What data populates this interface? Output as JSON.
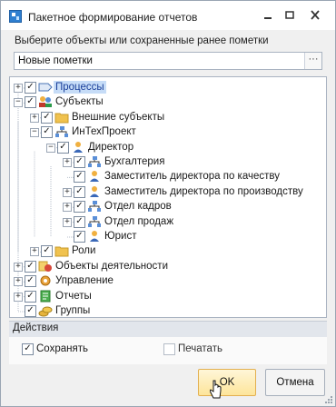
{
  "window": {
    "title": "Пакетное формирование отчетов"
  },
  "prompt": "Выберите объекты или сохраненные ранее пометки",
  "combo": {
    "value": "Новые пометки",
    "button": "···"
  },
  "tree": [
    {
      "label": "Процессы",
      "icon": "process-icon",
      "expander": "+",
      "checked": true,
      "selected": true
    },
    {
      "label": "Субъекты",
      "icon": "people-icon",
      "expander": "−",
      "checked": true
    },
    {
      "label": "Внешние субъекты",
      "icon": "folder-icon",
      "expander": "+",
      "checked": true
    },
    {
      "label": "ИнТехПроект",
      "icon": "org-icon",
      "expander": "−",
      "checked": true
    },
    {
      "label": "Директор",
      "icon": "person-icon",
      "expander": "−",
      "checked": true
    },
    {
      "label": "Бухгалтерия",
      "icon": "org-icon",
      "expander": "+",
      "checked": true
    },
    {
      "label": "Заместитель директора по качеству",
      "icon": "person-icon",
      "expander": "",
      "checked": true
    },
    {
      "label": "Заместитель директора по производству",
      "icon": "person-icon",
      "expander": "+",
      "checked": true
    },
    {
      "label": "Отдел кадров",
      "icon": "org-icon",
      "expander": "+",
      "checked": true
    },
    {
      "label": "Отдел продаж",
      "icon": "org-icon",
      "expander": "+",
      "checked": true
    },
    {
      "label": "Юрист",
      "icon": "person-icon",
      "expander": "",
      "checked": true
    },
    {
      "label": "Роли",
      "icon": "folder-icon",
      "expander": "+",
      "checked": true
    },
    {
      "label": "Объекты деятельности",
      "icon": "objects-icon",
      "expander": "+",
      "checked": true
    },
    {
      "label": "Управление",
      "icon": "gear-icon",
      "expander": "+",
      "checked": true
    },
    {
      "label": "Отчеты",
      "icon": "report-icon",
      "expander": "+",
      "checked": true
    },
    {
      "label": "Группы",
      "icon": "coins-icon",
      "expander": "",
      "checked": true
    }
  ],
  "actions": {
    "title": "Действия",
    "save_label": "Сохранять",
    "save_checked": true,
    "print_label": "Печатать",
    "print_checked": false
  },
  "buttons": {
    "ok": "OK",
    "cancel": "Отмена"
  },
  "colors": {
    "selection": "#c6dcf7",
    "ok_button": "#fde59a",
    "folder": "#f0c24f"
  }
}
